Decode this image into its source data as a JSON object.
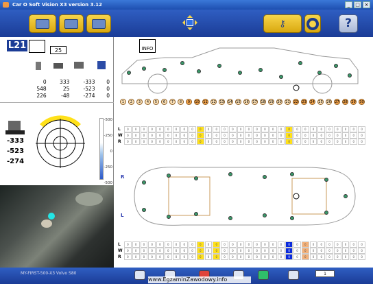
{
  "window": {
    "title": "Car O Soft Vision X3 version 3.12"
  },
  "toolbar": {
    "help_label": "?"
  },
  "left_panel": {
    "point_id": "L21",
    "point_number": "25",
    "measurements": [
      [
        "0",
        "333",
        "-333",
        "0"
      ],
      [
        "548",
        "25",
        "-523",
        "0"
      ],
      [
        "226",
        "-48",
        "-274",
        "0"
      ]
    ],
    "deviation": {
      "values": [
        "-333",
        "-523",
        "-274"
      ],
      "scale": [
        "-500",
        "-250",
        "0",
        "-250",
        "-500"
      ]
    }
  },
  "diagram": {
    "info_label": "INFO",
    "points": [
      "1",
      "2",
      "3",
      "4",
      "5",
      "6",
      "7",
      "8",
      "9",
      "10",
      "11",
      "12",
      "13",
      "14",
      "15",
      "16",
      "17",
      "18",
      "19",
      "20",
      "21",
      "22",
      "23",
      "24",
      "25",
      "26",
      "27",
      "28",
      "29",
      "30"
    ],
    "row_labels": {
      "L": "L",
      "W": "W",
      "R": "R"
    },
    "side_right": "R",
    "side_left": "L"
  },
  "status": {
    "vehicle": "MY-FIRST-500-X3   Volvo   S80"
  },
  "watermark": "www.EgzaminZawodowy.info"
}
